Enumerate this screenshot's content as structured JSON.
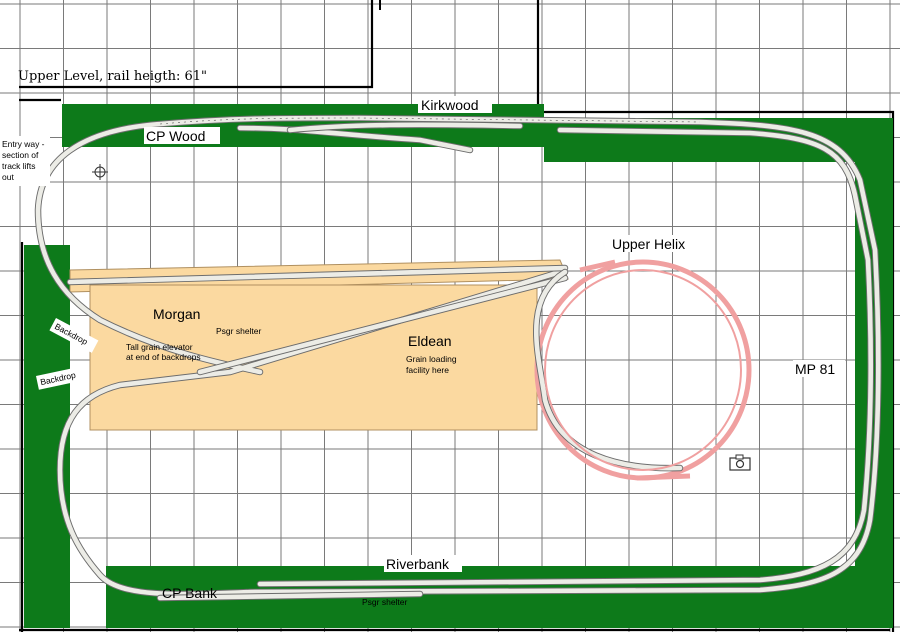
{
  "title": "Upper Level, rail heigth: 61\"",
  "locations": {
    "kirkwood": "Kirkwood",
    "cp_wood": "CP Wood",
    "upper_helix": "Upper Helix",
    "morgan": "Morgan",
    "eldean": "Eldean",
    "mp81": "MP 81",
    "riverbank": "Riverbank",
    "cp_bank": "CP Bank"
  },
  "notes": {
    "entry_line1": "Entry way -",
    "entry_line2": "section of",
    "entry_line3": "track lifts",
    "entry_line4": "out",
    "psgr_shelter_morgan": "Psgr shelter",
    "grain_elevator_line1": "Tall grain elevator",
    "grain_elevator_line2": "at end of backdrops",
    "grain_loading_line1": "Grain loading",
    "grain_loading_line2": "facility here",
    "backdrop_upper": "Backdrop",
    "backdrop_lower": "Backdrop",
    "psgr_shelter_riverbank": "Psgr shelter"
  },
  "icons": {
    "camera": "camera-icon",
    "crosshair": "crosshair-icon"
  },
  "colors": {
    "benchwork": "#0d7a1a",
    "scenery": "#fbd9a0",
    "helix": "#f0a0a0",
    "track": "#ecece6"
  }
}
